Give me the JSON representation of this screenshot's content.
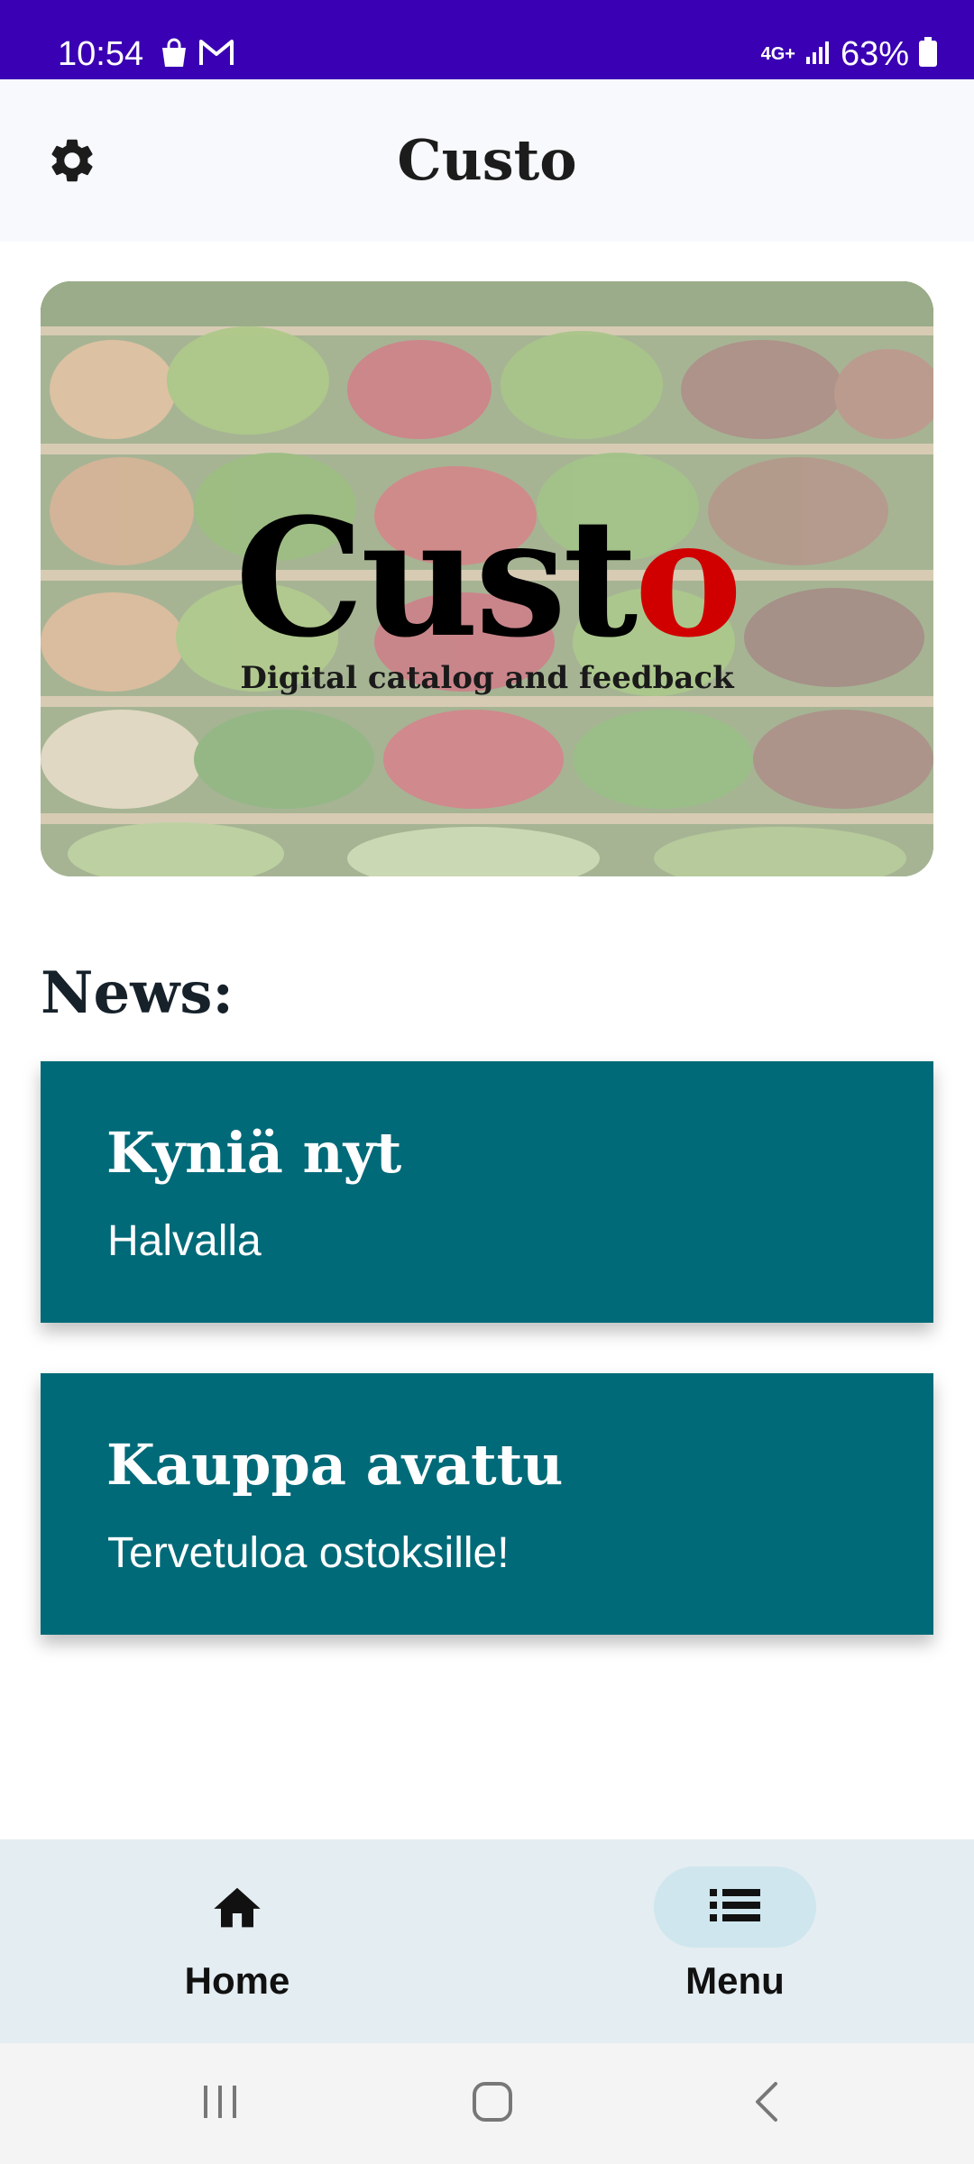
{
  "status_bar": {
    "time": "10:54",
    "network": "4G+",
    "battery": "63%",
    "icons": [
      "shopping-bag-icon",
      "gmail-icon",
      "signal-icon",
      "battery-icon"
    ]
  },
  "app_bar": {
    "title": "Custo",
    "settings_icon": "gear-icon"
  },
  "hero": {
    "logo_main": "Cust",
    "logo_accent": "o",
    "tagline": "Digital catalog and feedback",
    "accent_color": "#d10000"
  },
  "news": {
    "heading": "News:",
    "items": [
      {
        "title": "Kyniä nyt",
        "body": "Halvalla"
      },
      {
        "title": "Kauppa avattu",
        "body": "Tervetuloa ostoksille!"
      }
    ],
    "card_color": "#006a78"
  },
  "bottom_nav": {
    "items": [
      {
        "label": "Home",
        "icon": "home-icon",
        "selected": false
      },
      {
        "label": "Menu",
        "icon": "list-icon",
        "selected": true
      }
    ]
  },
  "system_nav": {
    "icons": [
      "recents-icon",
      "home-circle-icon",
      "back-icon"
    ]
  },
  "colors": {
    "status_bar": "#3a00b3",
    "app_bar": "#f7f9fc",
    "nav_bar": "#e4edf1"
  }
}
